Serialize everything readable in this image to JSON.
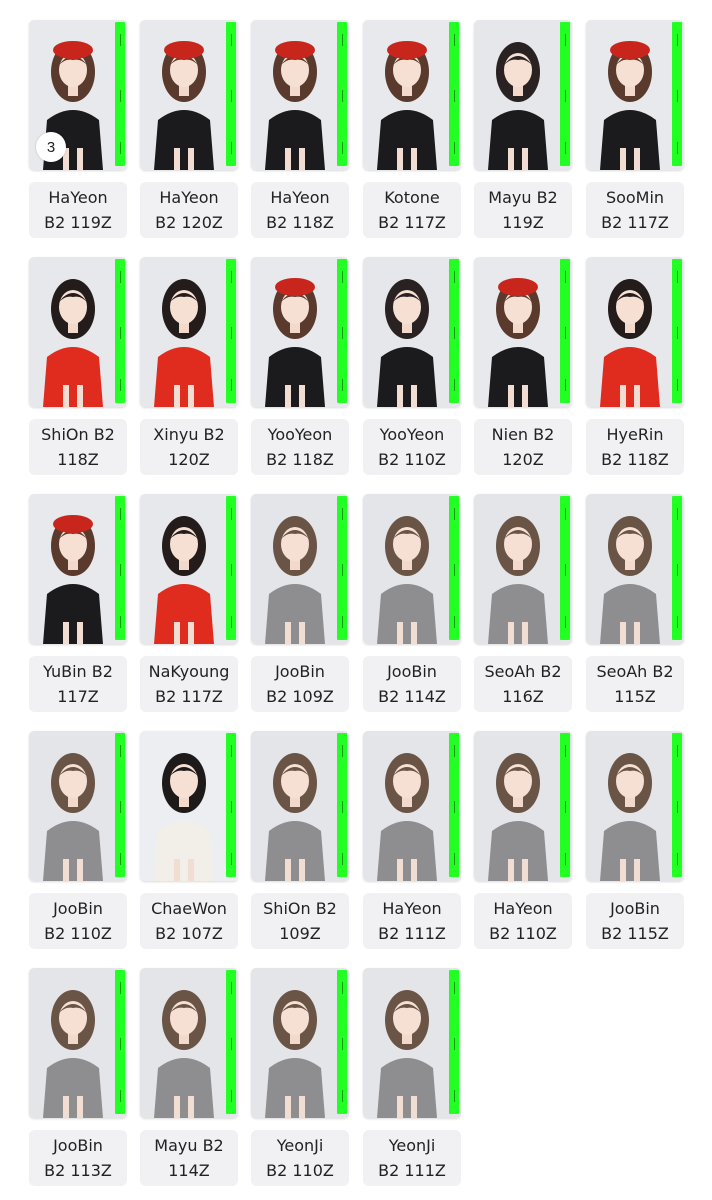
{
  "cards": [
    {
      "line1": "HaYeon",
      "line2": "B2 119Z",
      "badge": "3",
      "theme": "red-beret"
    },
    {
      "line1": "HaYeon",
      "line2": "B2 120Z",
      "theme": "red-beret"
    },
    {
      "line1": "HaYeon",
      "line2": "B2 118Z",
      "theme": "red-beret"
    },
    {
      "line1": "Kotone",
      "line2": "B2 117Z",
      "theme": "red-beret"
    },
    {
      "line1": "Mayu B2",
      "line2": "119Z",
      "theme": "black-outfit"
    },
    {
      "line1": "SooMin",
      "line2": "B2 117Z",
      "theme": "red-beret"
    },
    {
      "line1": "ShiOn B2",
      "line2": "118Z",
      "theme": "red-sweater"
    },
    {
      "line1": "Xinyu B2",
      "line2": "120Z",
      "theme": "red-sweater"
    },
    {
      "line1": "YooYeon",
      "line2": "B2 118Z",
      "theme": "red-beret"
    },
    {
      "line1": "YooYeon",
      "line2": "B2 110Z",
      "theme": "black-outfit"
    },
    {
      "line1": "Nien B2",
      "line2": "120Z",
      "theme": "red-beret"
    },
    {
      "line1": "HyeRin",
      "line2": "B2 118Z",
      "theme": "red-sweater"
    },
    {
      "line1": "YuBin B2",
      "line2": "117Z",
      "theme": "red-beret"
    },
    {
      "line1": "NaKyoung",
      "line2": "B2 117Z",
      "theme": "red-sweater"
    },
    {
      "line1": "JooBin",
      "line2": "B2 109Z",
      "theme": "grey-hoodie"
    },
    {
      "line1": "JooBin",
      "line2": "B2 114Z",
      "theme": "grey-hoodie"
    },
    {
      "line1": "SeoAh B2",
      "line2": "116Z",
      "theme": "grey-hoodie"
    },
    {
      "line1": "SeoAh B2",
      "line2": "115Z",
      "theme": "grey-hoodie"
    },
    {
      "line1": "JooBin",
      "line2": "B2 110Z",
      "theme": "grey-hoodie"
    },
    {
      "line1": "ChaeWon",
      "line2": "B2 107Z",
      "theme": "white-knit"
    },
    {
      "line1": "ShiOn B2",
      "line2": "109Z",
      "theme": "grey-hoodie"
    },
    {
      "line1": "HaYeon",
      "line2": "B2 111Z",
      "theme": "grey-hoodie"
    },
    {
      "line1": "HaYeon",
      "line2": "B2 110Z",
      "theme": "grey-hoodie"
    },
    {
      "line1": "JooBin",
      "line2": "B2 115Z",
      "theme": "grey-hoodie"
    },
    {
      "line1": "JooBin",
      "line2": "B2 113Z",
      "theme": "grey-hoodie"
    },
    {
      "line1": "Mayu B2",
      "line2": "114Z",
      "theme": "grey-hoodie"
    },
    {
      "line1": "YeonJi",
      "line2": "B2 110Z",
      "theme": "grey-hoodie"
    },
    {
      "line1": "YeonJi",
      "line2": "B2 111Z",
      "theme": "grey-hoodie"
    }
  ],
  "colors": {
    "sidebar_green": "#22ff22",
    "label_bg": "#f1f1f3",
    "beret_red": "#c8261c",
    "sweater_red": "#e02b1f",
    "hoodie_grey": "#8e8e90",
    "outfit_black": "#1b1b1d",
    "photo_bg": "#e9eaee"
  }
}
